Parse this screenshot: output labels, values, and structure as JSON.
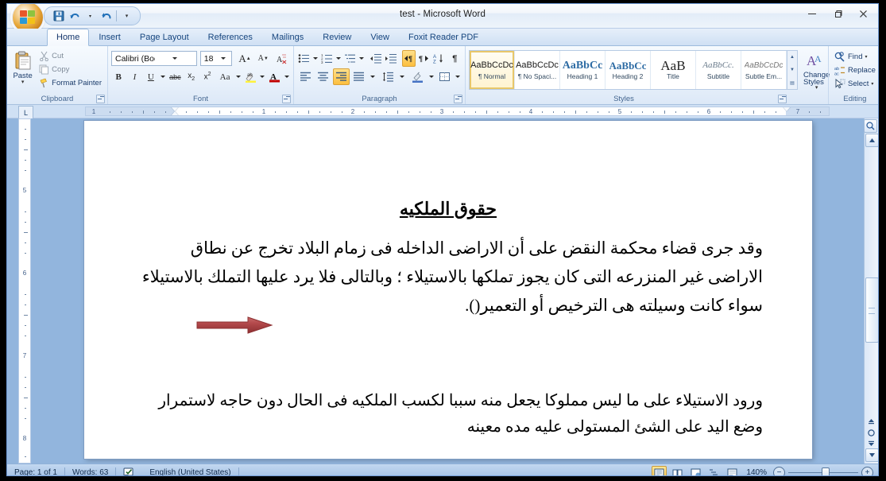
{
  "window": {
    "title": "test - Microsoft Word",
    "minimize": "–",
    "maximize": "❐",
    "close": "✕"
  },
  "quick_access": {
    "office_button": "office-button",
    "save": "Save",
    "undo": "Undo",
    "redo": "Redo",
    "customize": "Customize Quick Access Toolbar"
  },
  "tabs": [
    {
      "label": "Home",
      "active": true
    },
    {
      "label": "Insert",
      "active": false
    },
    {
      "label": "Page Layout",
      "active": false
    },
    {
      "label": "References",
      "active": false
    },
    {
      "label": "Mailings",
      "active": false
    },
    {
      "label": "Review",
      "active": false
    },
    {
      "label": "View",
      "active": false
    },
    {
      "label": "Foxit Reader PDF",
      "active": false
    }
  ],
  "ribbon": {
    "clipboard": {
      "label": "Clipboard",
      "paste": "Paste",
      "cut": "Cut",
      "copy": "Copy",
      "format_painter": "Format Painter"
    },
    "font": {
      "label": "Font",
      "font_name": "Calibri (Body)",
      "font_size": "18",
      "grow_font": "A",
      "shrink_font": "A",
      "clear_formatting": "Clear Formatting",
      "bold": "B",
      "italic": "I",
      "underline": "U",
      "strikethrough": "abc",
      "subscript": "x₂",
      "superscript": "x²",
      "change_case": "Aa",
      "highlight": "ab",
      "font_color": "A"
    },
    "paragraph": {
      "label": "Paragraph",
      "bullets": "Bullets",
      "numbering": "Numbering",
      "multilevel": "Multilevel List",
      "decrease_indent": "Decrease Indent",
      "increase_indent": "Increase Indent",
      "ltr": "Left-to-Right Text Direction",
      "rtl": "Right-to-Left Text Direction",
      "sort": "Sort",
      "show_marks": "¶",
      "align_left": "Align Text Left",
      "align_center": "Center",
      "align_right": "Align Text Right",
      "justify": "Justify",
      "line_spacing": "Line Spacing",
      "shading": "Shading",
      "borders": "Borders"
    },
    "styles": {
      "label": "Styles",
      "items": [
        {
          "preview": "AaBbCcDc",
          "name": "¶ Normal",
          "selected": true
        },
        {
          "preview": "AaBbCcDc",
          "name": "¶ No Spaci...",
          "selected": false
        },
        {
          "preview": "AaBbCc",
          "name": "Heading 1",
          "selected": false
        },
        {
          "preview": "AaBbCc",
          "name": "Heading 2",
          "selected": false
        },
        {
          "preview": "AaB",
          "name": "Title",
          "selected": false
        },
        {
          "preview": "AaBbCc.",
          "name": "Subtitle",
          "selected": false
        },
        {
          "preview": "AaBbCcDc",
          "name": "Subtle Em...",
          "selected": false
        }
      ],
      "change_styles": "Change Styles"
    },
    "editing": {
      "label": "Editing",
      "find": "Find",
      "replace": "Replace",
      "select": "Select"
    }
  },
  "ruler": {
    "tab_selector": "L",
    "horizontal_numbers": [
      "1",
      "1",
      "2",
      "3",
      "4",
      "5",
      "6",
      "7"
    ],
    "vertical_numbers": [
      "5",
      "6",
      "7",
      "8"
    ]
  },
  "document": {
    "title": "حقوق الملكيه",
    "paragraph1": "وقد جرى قضاء محكمة النقض على أن الاراضى الداخله فى زمام البلاد تخرج عن نطاق الاراضى غير المنزرعه التى كان يجوز تملكها بالاستيلاء ؛ وبالتالى فلا يرد عليها التملك بالاستيلاء سواء كانت وسيلته هى الترخيص أو التعمير().",
    "paragraph2": "ورود الاستيلاء على ما ليس مملوكا يجعل منه سببا لكسب الملكيه فى الحال دون حاجه لاستمرار وضع اليد على الشئ المستولى عليه مده معينه",
    "annotation_arrow": "red-right-arrow",
    "arrow_color": "#b2484a"
  },
  "status_bar": {
    "page": "Page: 1 of 1",
    "words": "Words: 63",
    "proofing": "proofing-errors-icon",
    "language": "English (United States)",
    "views": [
      {
        "name": "print-layout",
        "active": true
      },
      {
        "name": "full-screen-reading",
        "active": false
      },
      {
        "name": "web-layout",
        "active": false
      },
      {
        "name": "outline",
        "active": false
      },
      {
        "name": "draft",
        "active": false
      }
    ],
    "zoom": "140%",
    "zoom_out": "−",
    "zoom_in": "+"
  }
}
